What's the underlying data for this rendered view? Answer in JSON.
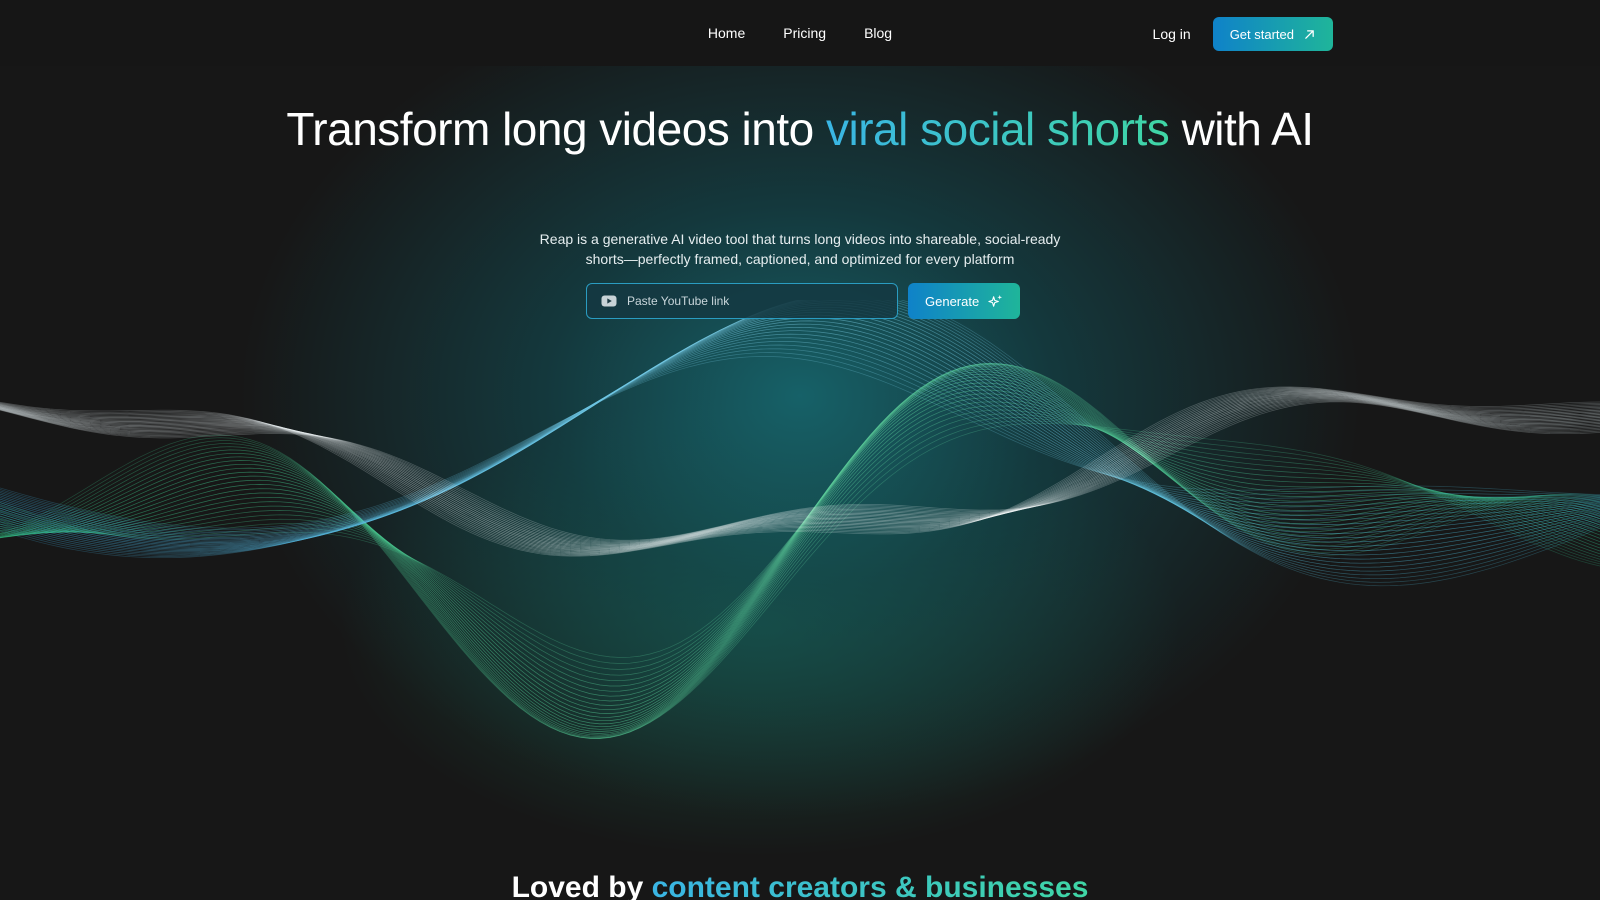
{
  "nav": {
    "links": [
      "Home",
      "Pricing",
      "Blog"
    ],
    "login_label": "Log in",
    "cta_label": "Get started"
  },
  "hero": {
    "headline_part1": "Transform long videos into ",
    "headline_highlight": "viral social shorts",
    "headline_part2": " with AI",
    "subtitle_line1": "Reap is a generative AI video tool that turns long videos into shareable, social-ready",
    "subtitle_line2": "shorts—perfectly framed, captioned, and optimized for every platform",
    "input_placeholder": "Paste YouTube link",
    "generate_label": "Generate"
  },
  "section2": {
    "heading_part1": "Loved by ",
    "heading_highlight": "content creators & businesses"
  },
  "icons": {
    "input": "youtube-icon",
    "generate": "sparkle-icon",
    "cta": "arrow-up-right-icon"
  },
  "colors": {
    "background": "#171717",
    "accent_blue": "#0f82c9",
    "accent_green": "#1fb59a",
    "highlight_start": "#3ab5e4",
    "highlight_end": "#3fd6a5"
  }
}
